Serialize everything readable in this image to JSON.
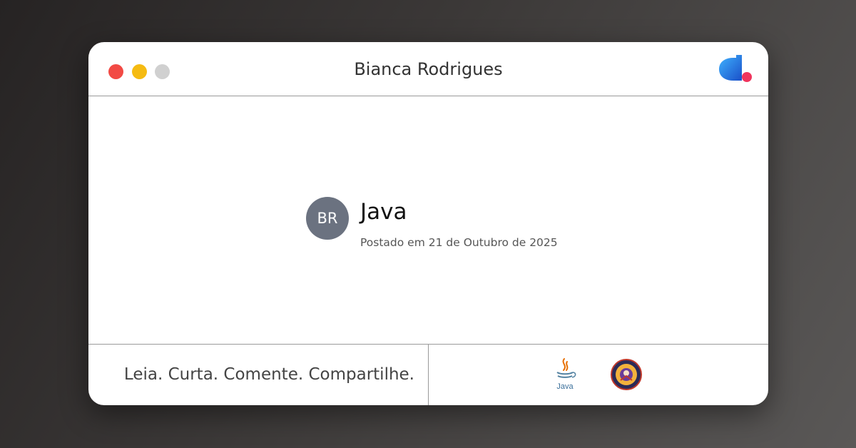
{
  "window": {
    "title": "Bianca Rodrigues",
    "controls": [
      "close",
      "minimize",
      "maximize"
    ]
  },
  "post": {
    "avatar_initials": "BR",
    "title": "Java",
    "date": "Postado em 21 de Outubro de 2025"
  },
  "footer": {
    "slogan": "Leia. Curta. Comente. Compartilhe.",
    "java_logo_text": "Java"
  },
  "icons": {
    "brand": "brand-logo-icon",
    "java": "java-logo-icon",
    "badge": "community-badge-icon"
  },
  "colors": {
    "close": "#f24a44",
    "minimize": "#f5bb12",
    "maximize": "#d0d0d0",
    "avatar": "#6b7280",
    "brand_blue": "#1e88e5",
    "brand_pink": "#f0345d"
  }
}
